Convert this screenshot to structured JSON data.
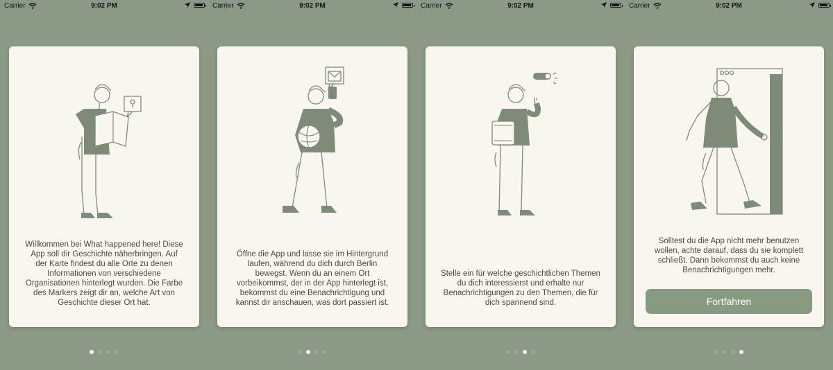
{
  "status_bar": {
    "carrier": "Carrier",
    "time": "9:02 PM"
  },
  "screens": [
    {
      "text": "Willkommen bei What happened here! Diese App soll dir Geschichte näherbringen. Auf der Karte findest du alle Orte zu denen Informationen von verschiedene Organisationen hinterlegt wurden. Die Farbe des Markers zeigt dir an, welche Art von Geschichte dieser Ort hat.",
      "active_page": 1,
      "illustration": "map-person-illustration"
    },
    {
      "text": "Öffne die App und lasse sie im Hintergrund laufen, während du dich durch Berlin bewegst. Wenn du an einem Ort vorbeikommst, der in der App hinterlegt ist, bekommst du eine Benachrichtigung und kannst dir anschauen, was dort passiert ist.",
      "active_page": 2,
      "illustration": "walking-person-phone-illustration"
    },
    {
      "text": "Stelle ein für welche geschichtlichen Themen du dich interessierst und erhalte nur Benachrichtigungen zu den Themen, die für dich spannend sind.",
      "active_page": 3,
      "illustration": "toggle-person-illustration"
    },
    {
      "text": "Solltest du die App nicht mehr benutzen wollen, achte darauf, dass du sie komplett schließt. Dann bekommst du auch keine Benachrichtigungen mehr.",
      "active_page": 4,
      "illustration": "door-person-illustration",
      "button_label": "Fortfahren"
    }
  ],
  "colors": {
    "background": "#8b9a86",
    "card": "#f8f6ee",
    "accent": "#879a82",
    "ink": "#7e8b79"
  },
  "icons": [
    "wifi-icon",
    "location-arrow-icon",
    "battery-icon"
  ]
}
